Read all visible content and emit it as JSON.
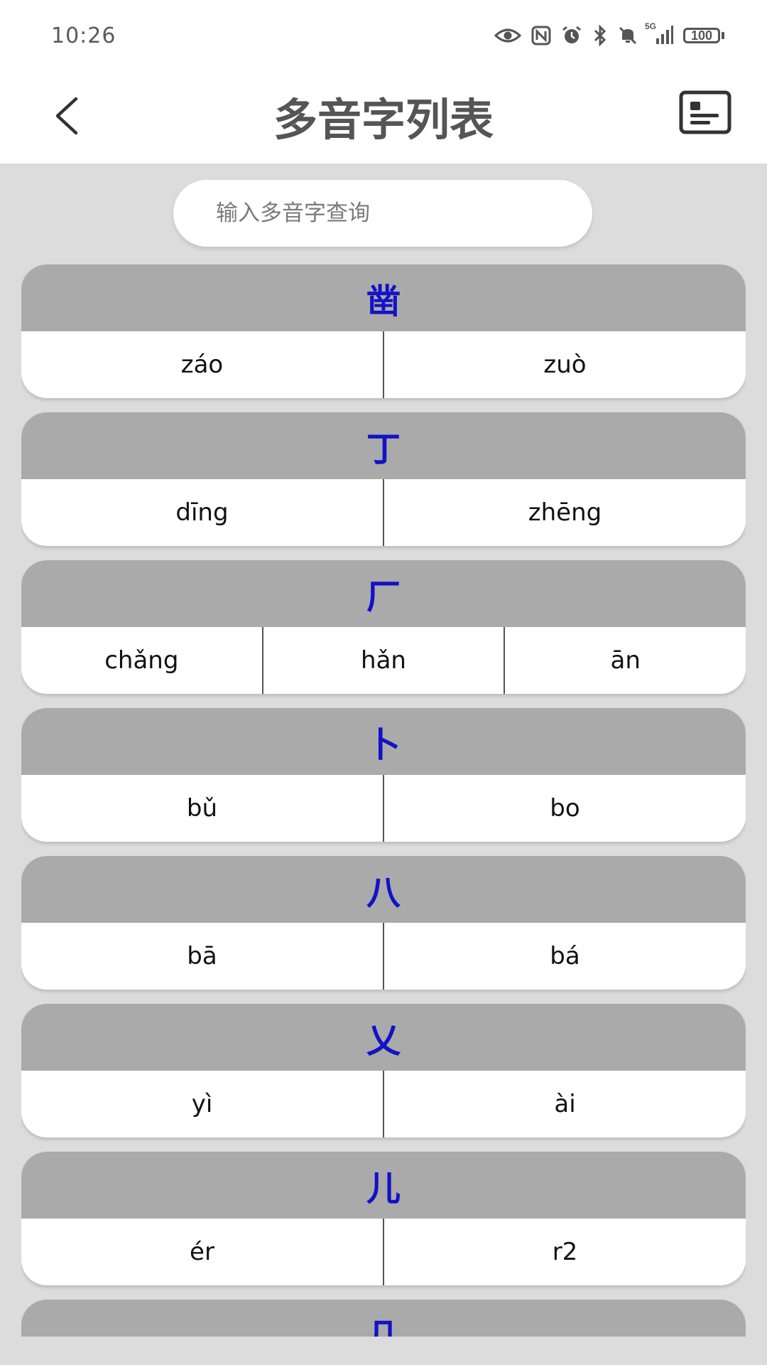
{
  "status_bar": {
    "time": "10:26",
    "network": "5G",
    "battery": "100",
    "icons": [
      "eye-icon",
      "nfc-icon",
      "alarm-icon",
      "bluetooth-icon",
      "mute-icon",
      "signal-icon",
      "battery-icon"
    ]
  },
  "header": {
    "title": "多音字列表",
    "back_icon": "chevron-left-icon",
    "list_icon": "list-card-icon"
  },
  "search": {
    "placeholder": "输入多音字查询",
    "value": ""
  },
  "items": [
    {
      "char": "凿",
      "pinyin": [
        "záo",
        "zuò"
      ]
    },
    {
      "char": "丁",
      "pinyin": [
        "dīng",
        "zhēng"
      ]
    },
    {
      "char": "厂",
      "pinyin": [
        "chǎng",
        "hǎn",
        "ān"
      ]
    },
    {
      "char": "卜",
      "pinyin": [
        "bǔ",
        "bo"
      ]
    },
    {
      "char": "八",
      "pinyin": [
        "bā",
        "bá"
      ]
    },
    {
      "char": "乂",
      "pinyin": [
        "yì",
        "ài"
      ]
    },
    {
      "char": "儿",
      "pinyin": [
        "ér",
        "r2"
      ]
    },
    {
      "char": "几",
      "pinyin": []
    }
  ],
  "colors": {
    "header_bg": "#ffffff",
    "page_bg": "#dcdcdc",
    "card_head_bg": "#aaaaaa",
    "char_color": "#1212c8"
  }
}
